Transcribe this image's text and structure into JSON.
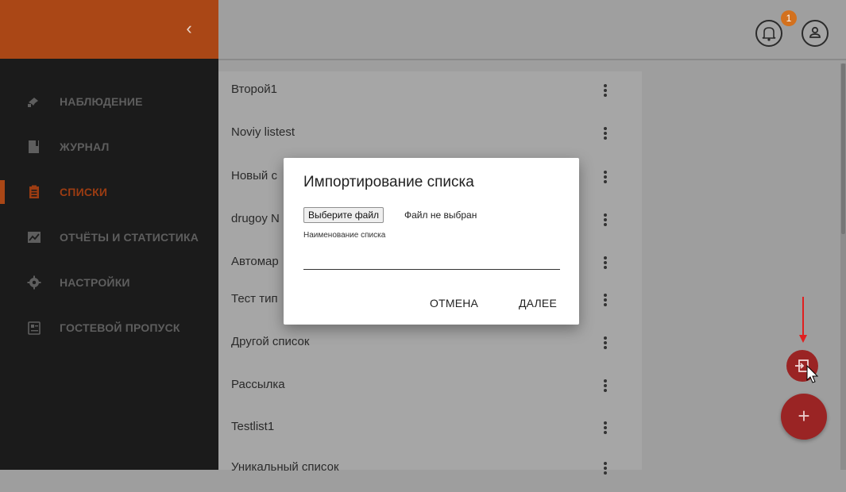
{
  "sidebar": {
    "collapse_icon": "chevron-left-icon",
    "accent_color": "#aa4716",
    "items": [
      {
        "label": "НАБЛЮДЕНИЕ",
        "icon": "camera-icon",
        "active": false
      },
      {
        "label": "ЖУРНАЛ",
        "icon": "book-icon",
        "active": false
      },
      {
        "label": "СПИСКИ",
        "icon": "clipboard-icon",
        "active": true
      },
      {
        "label": "ОТЧЁТЫ И СТАТИСТИКА",
        "icon": "chart-icon",
        "active": false
      },
      {
        "label": "НАСТРОЙКИ",
        "icon": "gear-icon",
        "active": false
      },
      {
        "label": "ГОСТЕВОЙ ПРОПУСК",
        "icon": "badge-icon",
        "active": false
      }
    ]
  },
  "header": {
    "notification_count": "1",
    "bell_icon": "bell-icon",
    "user_icon": "user-icon"
  },
  "lists": {
    "items": [
      "Второй1",
      "Noviy listest",
      "Новый с",
      "drugoy N",
      "Автомар",
      "Тест тип",
      "Другой список",
      "Рассылка",
      "Testlist1",
      "Уникальный список"
    ]
  },
  "dialog": {
    "title": "Импортирование списка",
    "file_button": "Выберите файл",
    "file_status": "Файл не выбран",
    "name_label": "Наименование списка",
    "name_value": "",
    "cancel": "ОТМЕНА",
    "next": "ДАЛЕЕ"
  },
  "fab": {
    "import_icon": "import-icon",
    "add_label": "+",
    "color": "#9a2424"
  }
}
